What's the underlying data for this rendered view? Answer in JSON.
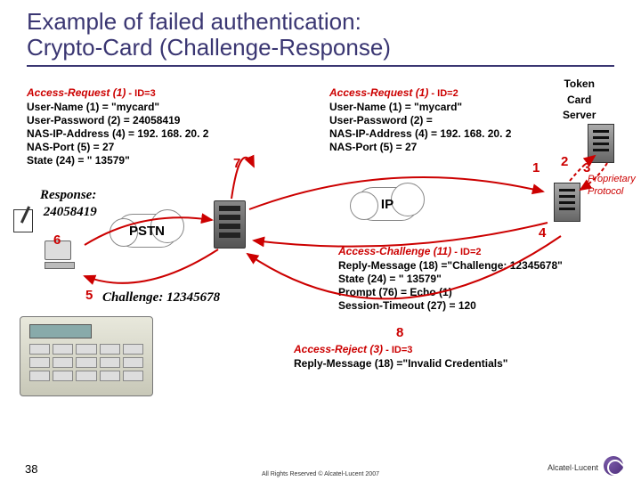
{
  "title_line1": "Example of failed authentication:",
  "title_line2": "Crypto-Card (Challenge-Response)",
  "req1": {
    "header": "Access-Request (1)",
    "id": " - ID=3",
    "l1": "User-Name (1) = \"mycard\"",
    "l2": "User-Password (2) = 24058419",
    "l3": "NAS-IP-Address (4) = 192. 168. 20. 2",
    "l4": "NAS-Port (5) = 27",
    "l5": "State (24) = \" 13579\""
  },
  "req2": {
    "header": "Access-Request (1)",
    "id": " - ID=2",
    "l1": "User-Name (1) = \"mycard\"",
    "l2": "User-Password (2) = ",
    "l3": "NAS-IP-Address (4) = 192. 168. 20. 2",
    "l4": "NAS-Port (5) = 27"
  },
  "challenge": {
    "header": "Access-Challenge (11)",
    "id": " - ID=2",
    "l1": "Reply-Message (18) =\"Challenge: 12345678\"",
    "l2": "State (24) = \" 13579\"",
    "l3": "Prompt (76) = Echo (1)",
    "l4": "Session-Timeout (27) = 120"
  },
  "reject": {
    "header": "Access-Reject (3)",
    "id": " - ID=3",
    "l1": "Reply-Message (18) =\"Invalid Credentials\""
  },
  "response_label": "Response:",
  "response_value": "24058419",
  "challenge_label": "Challenge: 12345678",
  "pstn": "PSTN",
  "ip": "IP",
  "token": "Token",
  "card": "Card",
  "server_lbl": "Server",
  "proprietary1": "Proprietary",
  "proprietary2": "Protocol",
  "steps": {
    "s1": "1",
    "s2": "2",
    "s3": "3",
    "s4": "4",
    "s5": "5",
    "s6": "6",
    "s7": "7",
    "s8": "8"
  },
  "page": "38",
  "copyright": "All Rights Reserved © Alcatel-Lucent 2007",
  "brand": "Alcatel·Lucent"
}
